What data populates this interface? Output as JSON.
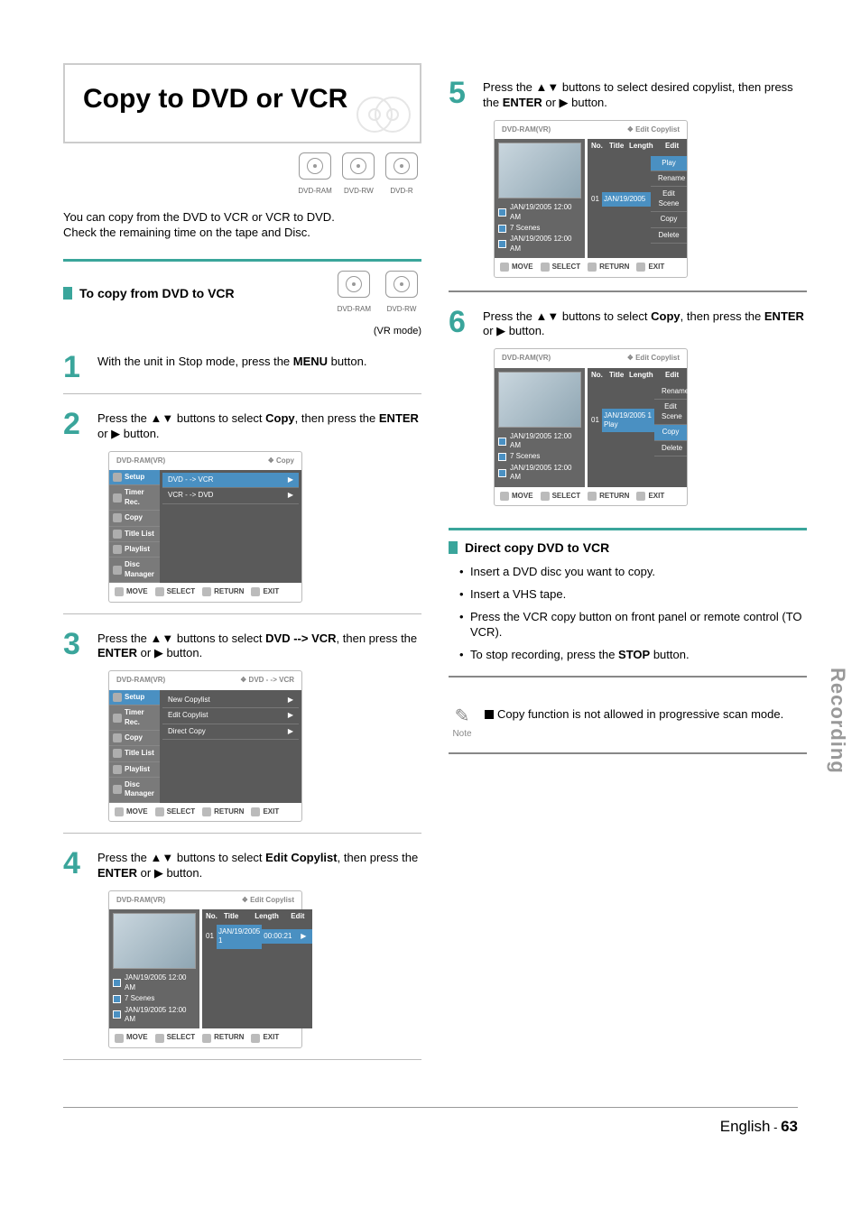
{
  "title": "Copy to DVD or VCR",
  "discTypes": [
    "DVD-RAM",
    "DVD-RW",
    "DVD-R"
  ],
  "intro1": "You can copy from the DVD to VCR or VCR to DVD.",
  "intro2": "Check the remaining time on the tape and Disc.",
  "section1": {
    "heading": "To copy from DVD to VCR",
    "discs": [
      "DVD-RAM",
      "DVD-RW"
    ],
    "vrmode": "(VR mode)"
  },
  "steps": {
    "s1": {
      "text_a": "With the unit in Stop mode, press the ",
      "bold": "MENU",
      "text_b": " button."
    },
    "s2": {
      "text_a": "Press the ▲▼ buttons to select ",
      "bold": "Copy",
      "text_b": ", then press the ",
      "bold2": "ENTER",
      "text_c": " or ▶ button."
    },
    "s3": {
      "text_a": "Press the ▲▼ buttons to select ",
      "bold": "DVD --> VCR",
      "text_b": ", then press the ",
      "bold2": "ENTER",
      "text_c": " or ▶ button."
    },
    "s4": {
      "text_a": "Press the ▲▼ buttons to select ",
      "bold": "Edit Copylist",
      "text_b": ", then press the ",
      "bold2": "ENTER",
      "text_c": " or ▶ button."
    },
    "s5": {
      "text_a": "Press the ▲▼ buttons to select desired copylist, then press the ",
      "bold": "ENTER",
      "text_b": " or ▶ button."
    },
    "s6": {
      "text_a": "Press the ▲▼ buttons to select ",
      "bold": "Copy",
      "text_b": ", then press the ",
      "bold2": "ENTER",
      "text_c": " or ▶ button."
    }
  },
  "screen_common": {
    "device": "DVD-RAM(VR)",
    "sidebar": [
      "Setup",
      "Timer Rec.",
      "Copy",
      "Title List",
      "Playlist",
      "Disc Manager"
    ],
    "footer": [
      "MOVE",
      "SELECT",
      "RETURN",
      "EXIT"
    ],
    "meta_date": "JAN/19/2005 12:00 AM",
    "meta_scenes": "7 Scenes"
  },
  "screen2": {
    "crumb": "❖  Copy",
    "rows": [
      "DVD - -> VCR",
      "VCR - -> DVD"
    ],
    "selected": 0
  },
  "screen3": {
    "crumb": "❖  DVD - -> VCR",
    "rows": [
      "New Copylist",
      "Edit Copylist",
      "Direct Copy"
    ]
  },
  "screen4": {
    "crumb": "❖  Edit Copylist",
    "header": [
      "No.",
      "Title",
      "Length",
      "Edit"
    ],
    "row": {
      "no": "01",
      "title": "JAN/19/2005 1",
      "length": "00:00:21",
      "edit": "▶"
    }
  },
  "screen5": {
    "crumb": "❖  Edit Copylist",
    "row": {
      "no": "01",
      "title": "JAN/19/2005"
    },
    "menu": [
      "Play",
      "Rename",
      "Edit Scene",
      "Copy",
      "Delete"
    ],
    "selected": 0
  },
  "screen6": {
    "crumb": "❖  Edit Copylist",
    "row": {
      "no": "01",
      "title": "JAN/19/2005 1",
      "action": "Play"
    },
    "menu": [
      "Rename",
      "Edit Scene",
      "Copy",
      "Delete"
    ],
    "selected": 2
  },
  "section2": {
    "heading": "Direct copy DVD to VCR",
    "bullets": [
      "Insert a DVD disc you want to copy.",
      "Insert a VHS tape.",
      {
        "a": "Press the VCR copy button on front panel or remote control (TO VCR)."
      },
      {
        "a": "To stop recording, press the ",
        "b": "STOP",
        "c": " button."
      }
    ]
  },
  "note": {
    "label": "Note",
    "text": "Copy function is not allowed in progressive scan mode."
  },
  "sideTab": "Recording",
  "footer": {
    "lang": "English",
    "sep": " - ",
    "page": "63"
  }
}
